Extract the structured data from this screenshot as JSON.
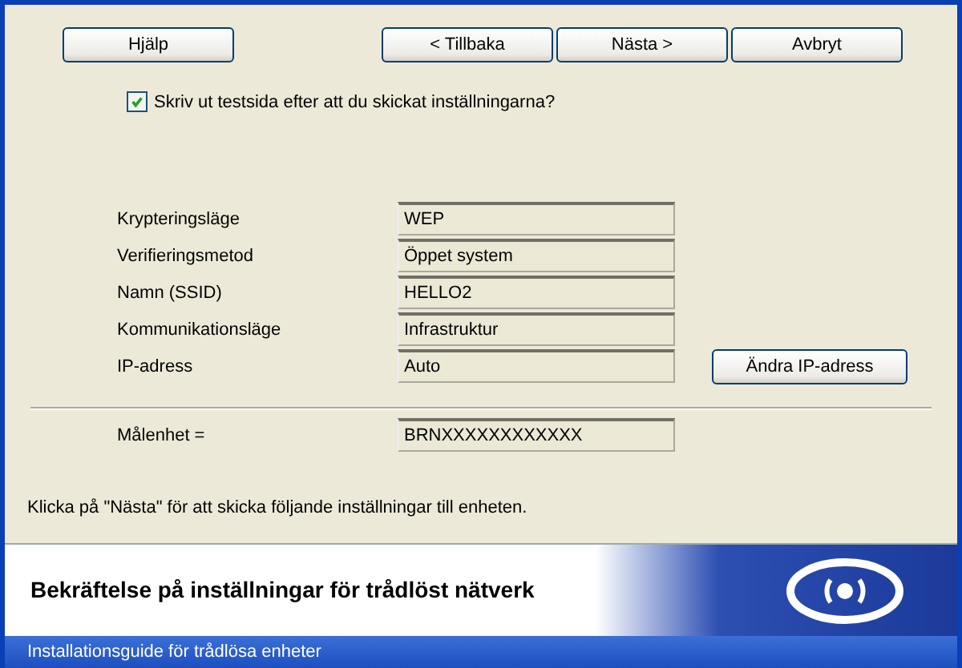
{
  "buttons": {
    "help": "Hjälp",
    "back": "< Tillbaka",
    "next": "Nästa >",
    "cancel": "Avbryt"
  },
  "print_test_page": {
    "label": "Skriv ut testsida efter att du skickat inställningarna?",
    "checked": true
  },
  "settings": [
    {
      "label": "Krypteringsläge",
      "value": "WEP"
    },
    {
      "label": "Verifieringsmetod",
      "value": "Öppet system"
    },
    {
      "label": "Namn (SSID)",
      "value": "HELLO2"
    },
    {
      "label": "Kommunikationsläge",
      "value": "Infrastruktur"
    },
    {
      "label": "IP-adress",
      "value": "Auto",
      "button": "Ändra IP-adress"
    }
  ],
  "target": {
    "label": "Målenhet =",
    "value": "BRNXXXXXXXXXXXX"
  },
  "instruction": "Klicka på \"Nästa\" för att skicka följande inställningar till enheten.",
  "header": {
    "title": "Bekräftelse på inställningar för trådlöst nätverk"
  },
  "window": {
    "title": "Installationsguide för trådlösa enheter"
  }
}
